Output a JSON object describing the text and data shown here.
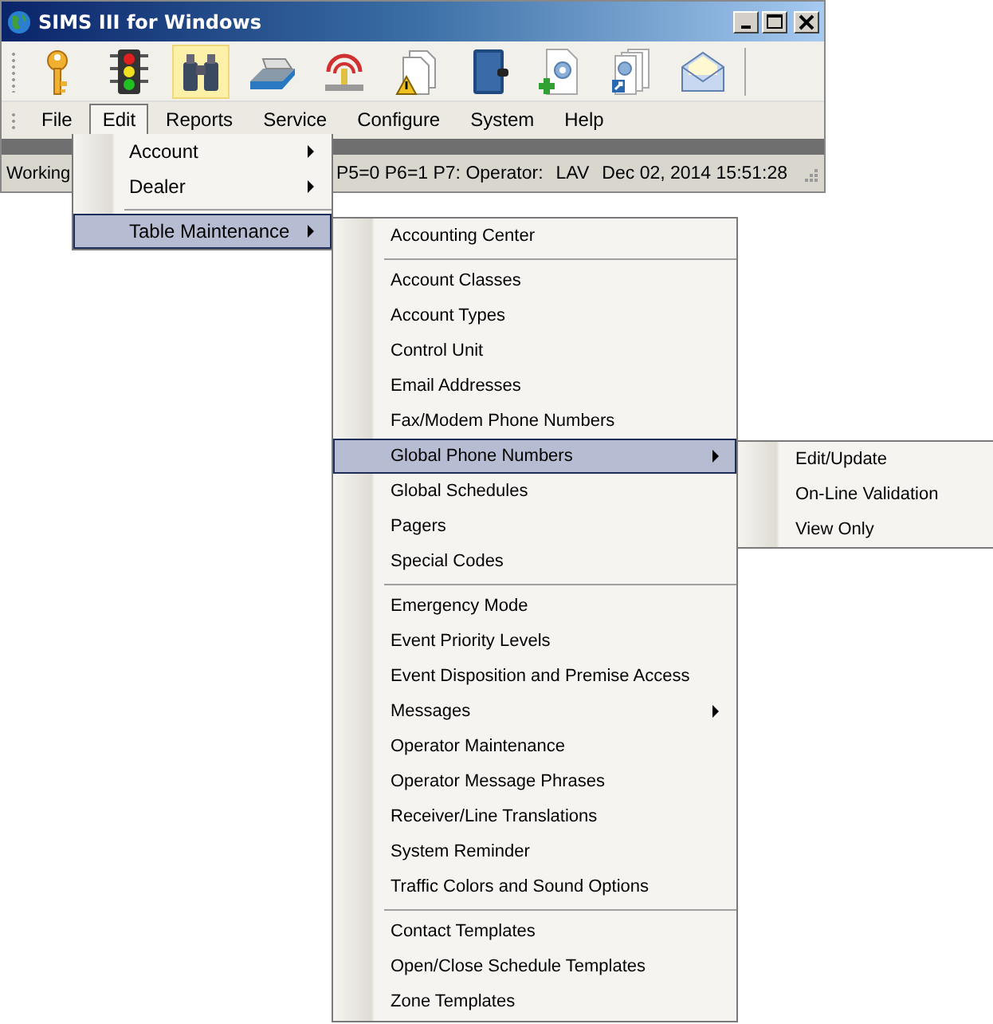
{
  "window": {
    "title": "SIMS III for Windows"
  },
  "toolbar": {
    "buttons": [
      {
        "kind": "key",
        "highlighted": false
      },
      {
        "kind": "traffic-light",
        "highlighted": false
      },
      {
        "kind": "binoculars",
        "highlighted": true
      },
      {
        "kind": "card-tray",
        "highlighted": false
      },
      {
        "kind": "antenna",
        "highlighted": false
      },
      {
        "kind": "documents-warning",
        "highlighted": false
      },
      {
        "kind": "book",
        "highlighted": false
      },
      {
        "kind": "document-gear-plus",
        "highlighted": false
      },
      {
        "kind": "documents-gear-shortcut",
        "highlighted": false
      },
      {
        "kind": "envelope",
        "highlighted": false
      }
    ]
  },
  "menu_bar": {
    "items": [
      {
        "label": "File",
        "selected": false
      },
      {
        "label": "Edit",
        "selected": true
      },
      {
        "label": "Reports",
        "selected": false
      },
      {
        "label": "Service",
        "selected": false
      },
      {
        "label": "Configure",
        "selected": false
      },
      {
        "label": "System",
        "selected": false
      },
      {
        "label": "Help",
        "selected": false
      }
    ]
  },
  "status_bar": {
    "fields": [
      "Working",
      "P5=0 P6=1 P7: Operator:",
      "LAV",
      "Dec 02, 2014 15:51:28"
    ]
  },
  "menus": [
    {
      "items": [
        {
          "kind": "item",
          "label": "Account",
          "has_submenu": true,
          "selected": false
        },
        {
          "kind": "item",
          "label": "Dealer",
          "has_submenu": true,
          "selected": false
        },
        {
          "kind": "separator"
        },
        {
          "kind": "item",
          "label": "Table Maintenance",
          "has_submenu": true,
          "selected": true
        }
      ]
    },
    {
      "items": [
        {
          "kind": "item",
          "label": "Accounting Center",
          "has_submenu": false,
          "selected": false
        },
        {
          "kind": "separator"
        },
        {
          "kind": "item",
          "label": "Account Classes",
          "has_submenu": false,
          "selected": false
        },
        {
          "kind": "item",
          "label": "Account Types",
          "has_submenu": false,
          "selected": false
        },
        {
          "kind": "item",
          "label": "Control Unit",
          "has_submenu": false,
          "selected": false
        },
        {
          "kind": "item",
          "label": "Email Addresses",
          "has_submenu": false,
          "selected": false
        },
        {
          "kind": "item",
          "label": "Fax/Modem Phone Numbers",
          "has_submenu": false,
          "selected": false
        },
        {
          "kind": "item",
          "label": "Global Phone Numbers",
          "has_submenu": true,
          "selected": true
        },
        {
          "kind": "item",
          "label": "Global Schedules",
          "has_submenu": false,
          "selected": false
        },
        {
          "kind": "item",
          "label": "Pagers",
          "has_submenu": false,
          "selected": false
        },
        {
          "kind": "item",
          "label": "Special Codes",
          "has_submenu": false,
          "selected": false
        },
        {
          "kind": "separator"
        },
        {
          "kind": "item",
          "label": "Emergency Mode",
          "has_submenu": false,
          "selected": false
        },
        {
          "kind": "item",
          "label": "Event Priority Levels",
          "has_submenu": false,
          "selected": false
        },
        {
          "kind": "item",
          "label": "Event Disposition and Premise Access",
          "has_submenu": false,
          "selected": false
        },
        {
          "kind": "item",
          "label": "Messages",
          "has_submenu": true,
          "selected": false
        },
        {
          "kind": "item",
          "label": "Operator Maintenance",
          "has_submenu": false,
          "selected": false
        },
        {
          "kind": "item",
          "label": "Operator Message Phrases",
          "has_submenu": false,
          "selected": false
        },
        {
          "kind": "item",
          "label": "Receiver/Line Translations",
          "has_submenu": false,
          "selected": false
        },
        {
          "kind": "item",
          "label": "System Reminder",
          "has_submenu": false,
          "selected": false
        },
        {
          "kind": "item",
          "label": "Traffic Colors and Sound Options",
          "has_submenu": false,
          "selected": false
        },
        {
          "kind": "separator"
        },
        {
          "kind": "item",
          "label": "Contact Templates",
          "has_submenu": false,
          "selected": false
        },
        {
          "kind": "item",
          "label": "Open/Close Schedule Templates",
          "has_submenu": false,
          "selected": false
        },
        {
          "kind": "item",
          "label": "Zone Templates",
          "has_submenu": false,
          "selected": false
        }
      ]
    },
    {
      "items": [
        {
          "kind": "item",
          "label": "Edit/Update",
          "has_submenu": false,
          "selected": false
        },
        {
          "kind": "item",
          "label": "On-Line Validation",
          "has_submenu": false,
          "selected": false
        },
        {
          "kind": "item",
          "label": "View Only",
          "has_submenu": false,
          "selected": false
        }
      ]
    }
  ]
}
